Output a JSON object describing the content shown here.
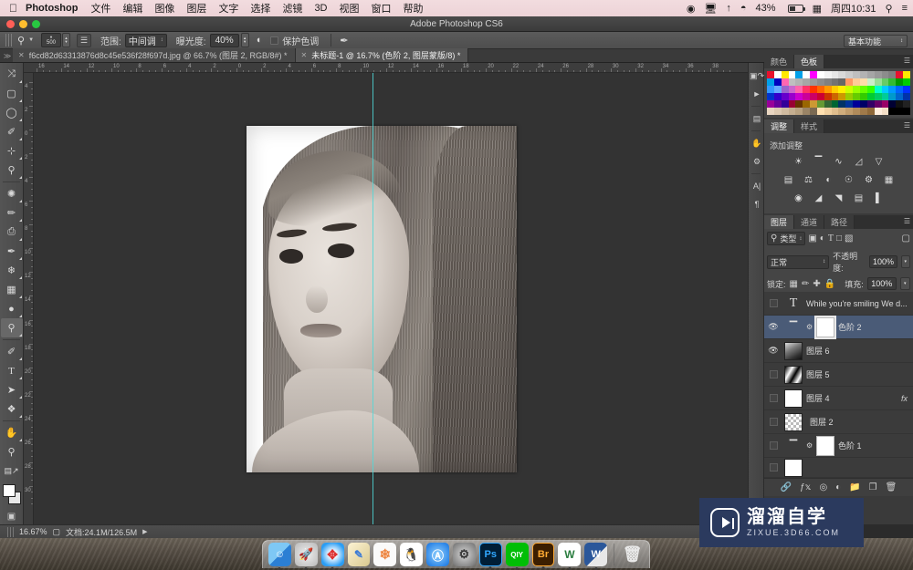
{
  "macbar": {
    "apple_icon": "apple-icon",
    "app_name": "Photoshop",
    "menus": [
      "文件",
      "编辑",
      "图像",
      "图层",
      "文字",
      "选择",
      "滤镜",
      "3D",
      "视图",
      "窗口",
      "帮助"
    ],
    "status_icons": [
      "airplay-icon",
      "screen-mirror-icon",
      "bluetooth-icon",
      "wifi-icon"
    ],
    "battery_percent": "43%",
    "date_time": "周四10:31",
    "search_icon": "search-icon",
    "notification_icon": "notification-center-icon",
    "calendar_icon": "calendar-icon"
  },
  "titlebar": {
    "title": "Adobe Photoshop CS6",
    "close_color": "#ff5f57",
    "minimize_color": "#ffbd2e",
    "zoom_color": "#28c941"
  },
  "optionsbar": {
    "tool_icon": "dodge-tool-icon",
    "brush_size": "500",
    "brush_panel_icon": "brush-panel-icon",
    "range_label": "范围:",
    "range_value": "中间调",
    "exposure_label": "曝光度:",
    "exposure_value": "40%",
    "airbrush_icon": "airbrush-icon",
    "protect_tones_label": "保护色调",
    "tablet_pressure_icon": "tablet-pressure-icon",
    "workspace": "基本功能"
  },
  "tabs": [
    {
      "label": "f6cd82d63313876d8c45e536f28f697d.jpg @ 66.7% (图层 2, RGB/8#) *",
      "active": false
    },
    {
      "label": "未标题-1 @ 16.7% (色阶 2, 图层蒙版/8) *",
      "active": true
    }
  ],
  "toolbar": {
    "tools": [
      {
        "name": "move-tool",
        "glyph": "⤧",
        "hasflyout": true,
        "selected": false
      },
      {
        "name": "marquee-tool",
        "glyph": "▢",
        "hasflyout": true,
        "selected": false
      },
      {
        "name": "lasso-tool",
        "glyph": "◯",
        "hasflyout": true,
        "selected": false
      },
      {
        "name": "quick-selection-tool",
        "glyph": "✎",
        "hasflyout": true,
        "selected": false
      },
      {
        "name": "crop-tool",
        "glyph": "⌗",
        "hasflyout": true,
        "selected": false
      },
      {
        "name": "eyedropper-tool",
        "glyph": "⚲",
        "hasflyout": true,
        "selected": false
      },
      {
        "name": "spot-healing-tool",
        "glyph": "✺",
        "hasflyout": true,
        "selected": false
      },
      {
        "name": "brush-tool",
        "glyph": "✏",
        "hasflyout": true,
        "selected": false
      },
      {
        "name": "clone-stamp-tool",
        "glyph": "⎙",
        "hasflyout": true,
        "selected": false
      },
      {
        "name": "history-brush-tool",
        "glyph": "✒",
        "hasflyout": true,
        "selected": false
      },
      {
        "name": "eraser-tool",
        "glyph": "◨",
        "hasflyout": true,
        "selected": false
      },
      {
        "name": "gradient-tool",
        "glyph": "▬",
        "hasflyout": true,
        "selected": false
      },
      {
        "name": "blur-tool",
        "glyph": "◍",
        "hasflyout": true,
        "selected": false
      },
      {
        "name": "dodge-tool",
        "glyph": "⌕",
        "hasflyout": true,
        "selected": true
      },
      {
        "name": "pen-tool",
        "glyph": "✐",
        "hasflyout": true,
        "selected": false
      },
      {
        "name": "type-tool",
        "glyph": "T",
        "hasflyout": true,
        "selected": false
      },
      {
        "name": "path-selection-tool",
        "glyph": "➤",
        "hasflyout": true,
        "selected": false
      },
      {
        "name": "shape-tool",
        "glyph": "❖",
        "hasflyout": true,
        "selected": false
      },
      {
        "name": "hand-tool",
        "glyph": "✋",
        "hasflyout": true,
        "selected": false
      },
      {
        "name": "zoom-tool",
        "glyph": "⌖",
        "hasflyout": false,
        "selected": false
      }
    ],
    "foreground_color": "#ffffff",
    "background_color": "#e8e8e8",
    "quickmask_icon": "quick-mask-icon"
  },
  "rulers": {
    "horizontal_ticks": [
      "16",
      "14",
      "12",
      "10",
      "8",
      "6",
      "4",
      "2",
      "0",
      "2",
      "4",
      "6",
      "8",
      "10",
      "12",
      "14",
      "16",
      "18",
      "20",
      "22",
      "24",
      "26",
      "28",
      "30",
      "32",
      "34",
      "36",
      "38"
    ],
    "vertical_ticks": [
      "4",
      "2",
      "0",
      "2",
      "4",
      "6",
      "8",
      "10",
      "12",
      "14",
      "16",
      "18",
      "20",
      "22",
      "24",
      "26",
      "28",
      "30"
    ],
    "units": "cm"
  },
  "canvas": {
    "document_description": "黑白人像照片 - 长直发女性",
    "guide_color": "#4fd8d8",
    "background_color": "#333333"
  },
  "dockstrip": {
    "icons": [
      "history-panel-icon",
      "actions-panel-icon",
      "properties-panel-icon",
      "brush-presets-icon",
      "brush-panel-icon",
      "character-panel-icon",
      "paragraph-panel-icon"
    ]
  },
  "panels": {
    "color": {
      "tabs": [
        {
          "label": "颜色",
          "on": false
        },
        {
          "label": "色板",
          "on": true
        }
      ],
      "menu_icon": "panel-menu-icon",
      "swatch_rows": [
        [
          "#e8112d",
          "#ffffff",
          "#ffe800",
          "#ffffff",
          "#00a0e9",
          "#ffffff",
          "#ff00ff",
          "#ffffff",
          "#f2f2f2",
          "#e6e6e6",
          "#d9d9d9",
          "#cccccc",
          "#bfbfbf",
          "#b3b3b3",
          "#a6a6a6",
          "#999999",
          "#8c8c8c",
          "#808080",
          "#e8112d",
          "#ffe800"
        ],
        [
          "#00a0e9",
          "#0000bf",
          "#ff66b2",
          "#bfbfbf",
          "#b3b3b3",
          "#a6a6a6",
          "#999999",
          "#8c8c8c",
          "#808080",
          "#737373",
          "#666666",
          "#ff9966",
          "#ffcc99",
          "#ffddaa",
          "#cceecc",
          "#99dd99",
          "#66cc66",
          "#33bb33",
          "#009900",
          "#00cc00"
        ],
        [
          "#3399ff",
          "#66aaff",
          "#9966cc",
          "#cc66cc",
          "#ff66aa",
          "#ff3366",
          "#ff3300",
          "#ff6600",
          "#ff9900",
          "#ffcc00",
          "#ffee00",
          "#ccff00",
          "#99ff00",
          "#66ff00",
          "#33ff00",
          "#00ffcc",
          "#00ccff",
          "#0099ff",
          "#0066ff",
          "#0033ff"
        ],
        [
          "#0033cc",
          "#3300cc",
          "#6600cc",
          "#9900cc",
          "#cc00cc",
          "#cc0099",
          "#cc0066",
          "#cc0033",
          "#cc3300",
          "#cc6600",
          "#cc9900",
          "#99cc00",
          "#66cc00",
          "#33cc00",
          "#00cc33",
          "#00cc66",
          "#00cc99",
          "#0099cc",
          "#0066cc",
          "#0033aa"
        ],
        [
          "#990099",
          "#660099",
          "#330099",
          "#990033",
          "#663300",
          "#996600",
          "#cc9933",
          "#669933",
          "#336633",
          "#006633",
          "#003366",
          "#003399",
          "#000099",
          "#000066",
          "#330066",
          "#660066",
          "#990066",
          "#000033",
          "#111111",
          "#222222"
        ],
        [
          "#e8d5c0",
          "#dcc8b0",
          "#d0bba0",
          "#c4ae90",
          "#b8a180",
          "#9a8466",
          "#7b6a52",
          "#ffe0b0",
          "#f0cf9f",
          "#e0be8e",
          "#d0ad7d",
          "#c09c6c",
          "#b08b5b",
          "#a07a4a",
          "#8f6939",
          "#ffeedd",
          "#f5e0c8",
          "#000000",
          "#000000",
          "#000000"
        ]
      ]
    },
    "adjustments": {
      "tabs": [
        {
          "label": "调整",
          "on": true
        },
        {
          "label": "样式",
          "on": false
        }
      ],
      "menu_icon": "panel-menu-icon",
      "title": "添加调整",
      "rows": [
        [
          "brightness-contrast-icon",
          "levels-icon",
          "curves-icon",
          "exposure-icon",
          "vibrance-icon"
        ],
        [
          "hue-saturation-icon",
          "color-balance-icon",
          "black-white-icon",
          "photo-filter-icon",
          "channel-mixer-icon",
          "color-lookup-icon"
        ],
        [
          "invert-icon",
          "posterize-icon",
          "threshold-icon",
          "selective-color-icon",
          "gradient-map-icon"
        ]
      ]
    },
    "layers": {
      "tabs": [
        {
          "label": "图层",
          "on": true
        },
        {
          "label": "通道",
          "on": false
        },
        {
          "label": "路径",
          "on": false
        }
      ],
      "menu_icon": "panel-menu-icon",
      "filter_icon": "search-icon",
      "filter_value": "类型",
      "filter_type_icons": [
        "pixel-filter-icon",
        "adjustment-filter-icon",
        "type-filter-icon",
        "shape-filter-icon",
        "smart-object-filter-icon"
      ],
      "filter_toggle_icon": "filter-toggle-icon",
      "blend_mode": "正常",
      "opacity_label": "不透明度:",
      "opacity_value": "100%",
      "lock_label": "锁定:",
      "lock_icons": [
        "lock-transparent-icon",
        "lock-image-icon",
        "lock-position-icon",
        "lock-all-icon"
      ],
      "fill_label": "填充:",
      "fill_value": "100%",
      "rows": [
        {
          "name": "While you're smiling We d...",
          "visible": false,
          "selected": false,
          "kind": "type",
          "fx": false
        },
        {
          "name": "色阶 2",
          "visible": true,
          "selected": true,
          "kind": "adjustment-mask",
          "fx": false
        },
        {
          "name": "图层 6",
          "visible": true,
          "selected": false,
          "kind": "image-portrait",
          "fx": false
        },
        {
          "name": "图层 5",
          "visible": false,
          "selected": false,
          "kind": "image-mask",
          "fx": false
        },
        {
          "name": "图层 4",
          "visible": false,
          "selected": false,
          "kind": "image-white",
          "fx": true,
          "fx_label": "fx"
        },
        {
          "name": "图层 2",
          "visible": false,
          "selected": false,
          "kind": "image-transparent",
          "fx": false
        },
        {
          "name": "色阶 1",
          "visible": false,
          "selected": false,
          "kind": "adjustment-mask",
          "fx": false
        }
      ],
      "footer_icons": [
        "link-layers-icon",
        "layer-style-icon",
        "add-mask-icon",
        "new-adjustment-icon",
        "new-group-icon",
        "new-layer-icon",
        "delete-layer-icon"
      ]
    }
  },
  "statusbar": {
    "zoom": "16.67%",
    "proxy_icon": "proxy-preview-icon",
    "doc_info": "文档:24.1M/126.5M",
    "arrow_icon": "chevron-right-icon"
  },
  "dock": {
    "items": [
      {
        "name": "finder",
        "glyph": "🙂",
        "color": "#3d9be9",
        "running": true
      },
      {
        "name": "launchpad",
        "glyph": "🚀",
        "color": "#cfcfcf",
        "running": false
      },
      {
        "name": "safari",
        "glyph": "🧭",
        "color": "#2a9df4",
        "running": true
      },
      {
        "name": "contacts",
        "glyph": "📒",
        "color": "#f3e3b6",
        "running": false
      },
      {
        "name": "photos",
        "glyph": "✿",
        "color": "#f4f4f4",
        "running": false
      },
      {
        "name": "qq",
        "glyph": "🐧",
        "color": "#ffffff",
        "running": false
      },
      {
        "name": "app-store",
        "glyph": "Ⓐ",
        "color": "#31a8ff",
        "running": false
      },
      {
        "name": "system-preferences",
        "glyph": "⚙",
        "color": "#8d8d8d",
        "running": false
      },
      {
        "name": "photoshop",
        "glyph": "Ps",
        "color": "#001e36",
        "running": true
      },
      {
        "name": "iqiyi",
        "glyph": "QIY",
        "color": "#00be06",
        "running": true
      },
      {
        "name": "bridge",
        "glyph": "Br",
        "color": "#3b1e00",
        "running": true
      },
      {
        "name": "wunderlist",
        "glyph": "W",
        "color": "#ffffff",
        "running": true
      },
      {
        "name": "word",
        "glyph": "W",
        "color": "#2b579a",
        "running": true
      }
    ],
    "trash": {
      "name": "trash",
      "glyph": "🗑"
    }
  },
  "watermark": {
    "cn": "溜溜自学",
    "en": "ZIXUE.3D66.COM",
    "logo_icon": "play-logo-icon",
    "bg_color": "#2b3a5e"
  }
}
